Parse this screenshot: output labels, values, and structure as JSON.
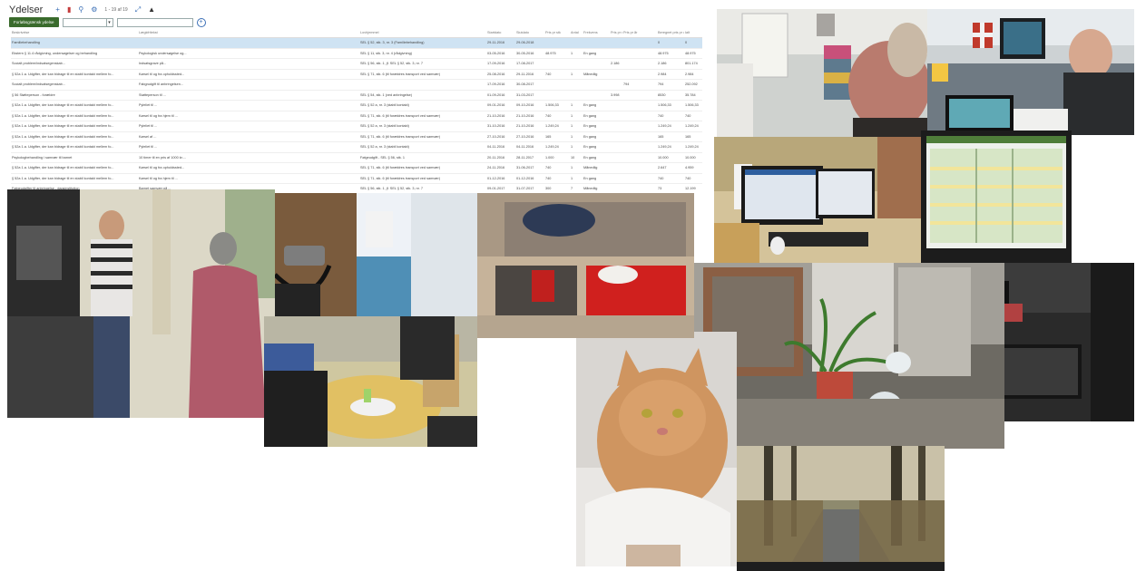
{
  "toolbar": {
    "title": "Ydelser",
    "count": "1 - 19 af 19"
  },
  "filter": {
    "button_label": "Forløbsgrænsk ydelse"
  },
  "table": {
    "columns": [
      "Beskrivelse",
      "Lægkfritekst",
      "Lovhjemmel",
      "Startdato",
      "Slutdato",
      "Pris pr stk",
      "Antal",
      "Frekvens",
      "Pris pr md",
      "Pris pr år",
      "Beregnet pris pr dag",
      "Ialt"
    ],
    "rows": [
      [
        "Familiebehandling",
        "",
        "SEL § 52, stk. 3, nr. 3 (Familiebehandling)",
        "29-11-2016",
        "29-06-2018",
        "",
        "",
        "",
        "",
        "",
        "0",
        "0"
      ],
      [
        "Ekstern § 11.4 rådgivning, undersøgelser og behandling",
        "Psykologisk undersøgelse og...",
        "SEL § 11, stk. 3, nr. 4 (rådgivning)",
        "03-05-2016",
        "30-05-2016",
        "48.975",
        "1",
        "En gang",
        "",
        "",
        "48.975",
        "48.975"
      ],
      [
        "Socialt problem/indsatsegenskab...",
        "Indsatsgrave på...",
        "SEL § 56, stk. 1, jf. SEL § 52, stk. 3, nr. 7",
        "17-09-2016",
        "17-08-2017",
        "",
        "",
        "",
        "2.186",
        "",
        "2.186",
        "801.174"
      ],
      [
        "§ 52a 1.a. Udgifter, der kan bidrage til en stabil kontakt mellem fo...",
        "Kørsel til og fra opholdssted...",
        "SEL § 71, stk. 6 (til forældres transport ved samvær)",
        "25-08-2016",
        "29-11-2016",
        "740",
        "1",
        "Månedlig",
        "",
        "",
        "2.984",
        "2.984"
      ],
      [
        "Socialt problem/indsatsegenskab...",
        "Fabgrudgift til anbringelsen...",
        "",
        "17-09-2016",
        "30-08-2017",
        "",
        "",
        "",
        "",
        "794",
        "794",
        "252.092"
      ],
      [
        "§ 56 Støtteperson - forældre",
        "Støtteperson til ...",
        "SEL § 54, stk. 1 (ved anbringelse)",
        "01-09-2016",
        "31-03-2017",
        "",
        "",
        "",
        "3.998",
        "",
        "8530",
        "35.784"
      ],
      [
        "§ 52a 1.a. Udgifter, der kan bidrage til en stabil kontakt mellem fo...",
        "Pyleliet til ...",
        "SEL § 52 a, nr. 3 (stabil kontakt)",
        "09-01-2016",
        "09-10-2016",
        "1.506,33",
        "1",
        "En gang",
        "",
        "",
        "1.506,33",
        "1.506,33"
      ],
      [
        "§ 52a 1.a. Udgifter, der kan bidrage til en stabil kontakt mellem fo...",
        "Kørsel til og fra hjem til ...",
        "SEL § 71, stk. 6 (til forældres transport ved samvær)",
        "21-10-2016",
        "21-10-2016",
        "740",
        "1",
        "En gang",
        "",
        "",
        "740",
        "740"
      ],
      [
        "§ 52a 1.a. Udgifter, der kan bidrage til en stabil kontakt mellem fo...",
        "Pyleliet til ...",
        "SEL § 52 a, nr. 3 (stabil kontakt)",
        "31-10-2016",
        "21-10-2016",
        "1.249,24",
        "1",
        "En gang",
        "",
        "",
        "1.249,24",
        "1.249,24"
      ],
      [
        "§ 52a 1.a. Udgifter, der kan bidrage til en stabil kontakt mellem fo...",
        "Kørsel af ...",
        "SEL § 71, stk. 6 (til forældres transport ved samvær)",
        "27-10-2016",
        "27-10-2016",
        "165",
        "1",
        "En gang",
        "",
        "",
        "165",
        "165"
      ],
      [
        "§ 52a 1.a. Udgifter, der kan bidrage til en stabil kontakt mellem fo...",
        "Pyleliet til ...",
        "SEL § 52 a, nr. 3 (stabil kontakt)",
        "04-11-2016",
        "04-11-2016",
        "1.249,24",
        "1",
        "En gang",
        "",
        "",
        "1.249,24",
        "1.249,24"
      ],
      [
        "Psykologbehandling i samvær til barnet",
        "10 timer til en pris af 1000 kr....",
        "Følgeudgift - SEL § 56, stk. 1",
        "20-11-2016",
        "28-11-2017",
        "1.000",
        "10",
        "En gang",
        "",
        "",
        "10.000",
        "10.000"
      ],
      [
        "§ 52a 1.a. Udgifter, der kan bidrage til en stabil kontakt mellem fo...",
        "Kørsel til og fra opholdssted...",
        "SEL § 71, stk. 6 (til forældres transport ved samvær)",
        "24-11-2016",
        "31-06-2017",
        "740",
        "1",
        "Månedlig",
        "",
        "",
        "2.647",
        "4.959"
      ],
      [
        "§ 52a 1.a. Udgifter, der kan bidrage til en stabil kontakt mellem fo...",
        "Kørsel til og fra hjem til ...",
        "SEL § 71, stk. 6 (til forældres transport ved samvær)",
        "01-12-2016",
        "01-12-2016",
        "740",
        "1",
        "En gang",
        "",
        "",
        "740",
        "740"
      ],
      [
        "Følgeudgifter til anbringelse - dagsinstitution",
        "Barnet samvær på ...",
        "SEL § 56, stk. 1, jf. SEL § 52, stk. 3, nr. 7",
        "09-01-2017",
        "31-07-2017",
        "300",
        "7",
        "Månedlig",
        "",
        "",
        "73",
        "12.199"
      ]
    ]
  }
}
